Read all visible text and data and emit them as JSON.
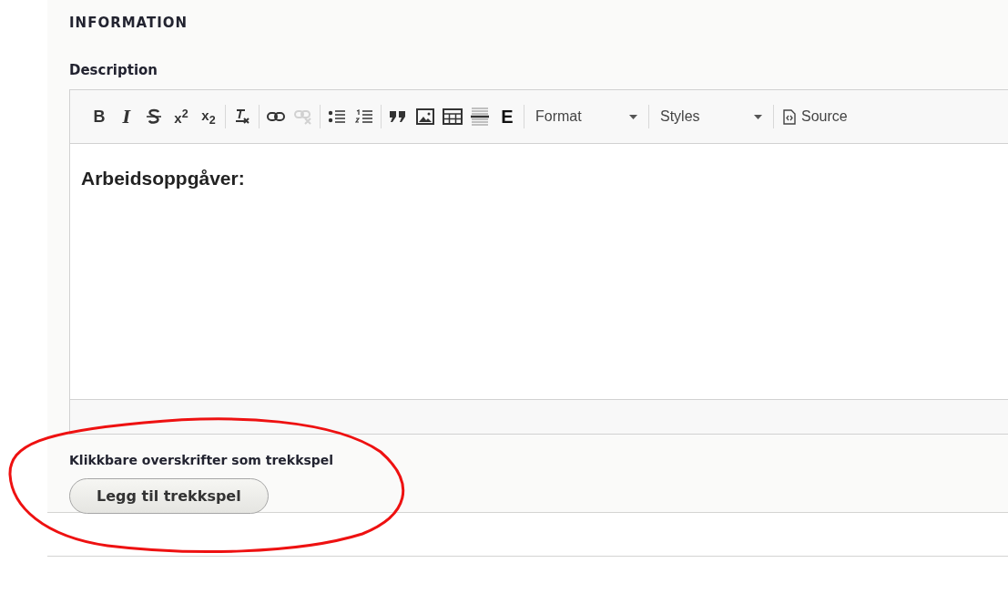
{
  "section": {
    "title": "INFORMATION"
  },
  "description": {
    "label": "Description",
    "toolbar": [
      [
        {
          "kind": "bold",
          "label": "B",
          "disabled": false
        },
        {
          "kind": "italic",
          "label": "I",
          "disabled": false
        },
        {
          "kind": "strike",
          "disabled": false
        },
        {
          "kind": "superscript",
          "label": "x$^{2}$",
          "disabled": false
        },
        {
          "kind": "subscript",
          "label": "x$_{2}$",
          "disabled": false
        }
      ],
      [
        {
          "kind": "clearformat",
          "disabled": false
        }
      ],
      [
        {
          "kind": "link",
          "disabled": false
        },
        {
          "kind": "unlink",
          "disabled": true
        }
      ],
      [
        {
          "kind": "bullets",
          "disabled": false
        },
        {
          "kind": "numbers",
          "disabled": false
        }
      ],
      [
        {
          "kind": "quote",
          "disabled": false
        },
        {
          "kind": "image",
          "disabled": false
        },
        {
          "kind": "table",
          "disabled": false
        },
        {
          "kind": "rule",
          "disabled": false
        },
        {
          "kind": "embed",
          "label": "E",
          "disabled": false
        }
      ],
      [
        {
          "kind": "combo",
          "label": "Format",
          "disabled": false
        }
      ],
      [
        {
          "kind": "combo",
          "label": "Styles",
          "disabled": false
        }
      ],
      [
        {
          "kind": "source",
          "label": "Source",
          "disabled": false
        }
      ]
    ],
    "content": "Arbeidsoppgåver:"
  },
  "accordion": {
    "label": "Klikkbare overskrifter som trekkspel",
    "button": "Legg til trekkspel"
  }
}
